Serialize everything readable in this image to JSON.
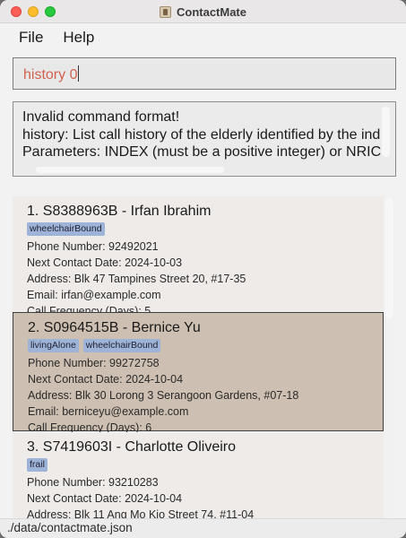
{
  "window": {
    "title": "ContactMate"
  },
  "menu": {
    "items": [
      "File",
      "Help"
    ]
  },
  "command": {
    "value": "history 0"
  },
  "result": {
    "lines": [
      "Invalid command format!",
      "history: List call history of the elderly identified by the index",
      "Parameters: INDEX (must be a positive integer) or NRIC"
    ]
  },
  "persons": [
    {
      "title": "1. S8388963B - Irfan Ibrahim",
      "tags": [
        "wheelchairBound"
      ],
      "phone": "Phone Number: 92492021",
      "next_contact": "Next Contact Date:  2024-10-03",
      "address": "Address: Blk 47 Tampines Street 20, #17-35",
      "email": "Email: irfan@example.com",
      "frequency": "Call Frequency (Days): 5",
      "selected": false
    },
    {
      "title": "2. S0964515B - Bernice Yu",
      "tags": [
        "livingAlone",
        "wheelchairBound"
      ],
      "phone": "Phone Number: 99272758",
      "next_contact": "Next Contact Date:  2024-10-04",
      "address": "Address: Blk 30 Lorong 3 Serangoon Gardens, #07-18",
      "email": "Email: berniceyu@example.com",
      "frequency": "Call Frequency (Days): 6",
      "selected": true
    },
    {
      "title": "3. S7419603I - Charlotte Oliveiro",
      "tags": [
        "frail"
      ],
      "phone": "Phone Number: 93210283",
      "next_contact": "Next Contact Date:  2024-10-04",
      "address": "Address: Blk 11 Ang Mo Kio Street 74, #11-04",
      "email": "",
      "frequency": "",
      "selected": false
    }
  ],
  "status": {
    "file_path": "./data/contactmate.json"
  }
}
